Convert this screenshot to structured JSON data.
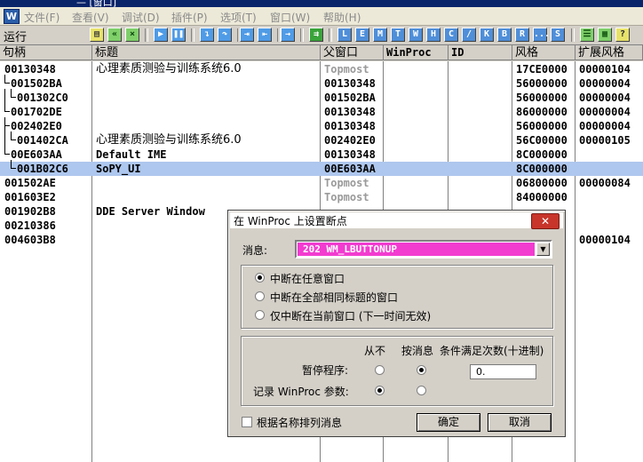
{
  "window": {
    "title_fragment": "— [窗口]"
  },
  "menu": [
    "文件(F)",
    "查看(V)",
    "调试(D)",
    "插件(P)",
    "选项(T)",
    "窗口(W)",
    "帮助(H)"
  ],
  "app_icon_letter": "W",
  "toolbar": {
    "run_label": "运行",
    "letter_buttons": [
      "L",
      "E",
      "M",
      "T",
      "W",
      "H",
      "C",
      "/",
      "K",
      "B",
      "R",
      "...",
      "S"
    ]
  },
  "columns": [
    "句柄",
    "标题",
    "父窗口",
    "WinProc",
    "ID",
    "风格",
    "扩展风格"
  ],
  "rows": [
    {
      "handle": "00130348",
      "title": "心理素质测验与训练系统6.0",
      "parent": "Topmost",
      "parent_grey": true,
      "style": "17CE0000",
      "exstyle": "00000104"
    },
    {
      "handle": "001502BA",
      "title": "",
      "parent": "00130348",
      "style": "56000000",
      "exstyle": "00000004"
    },
    {
      "handle": "001302C0",
      "title": "",
      "parent": "001502BA",
      "style": "56000000",
      "exstyle": "00000004"
    },
    {
      "handle": "001702DE",
      "title": "",
      "parent": "00130348",
      "style": "86000000",
      "exstyle": "00000004"
    },
    {
      "handle": "002402E0",
      "title": "",
      "parent": "00130348",
      "style": "56000000",
      "exstyle": "00000004"
    },
    {
      "handle": "001402CA",
      "title": "心理素质测验与训练系统6.0",
      "parent": "002402E0",
      "style": "56C00000",
      "exstyle": "00000105"
    },
    {
      "handle": "00E603AA",
      "title": "Default IME",
      "parent": "00130348",
      "style": "8C000000",
      "exstyle": ""
    },
    {
      "handle": "001B02C6",
      "title": "SoPY_UI",
      "parent": "00E603AA",
      "style": "8C000000",
      "exstyle": "",
      "selected": true
    },
    {
      "handle": "001502AE",
      "title": "",
      "parent": "Topmost",
      "parent_grey": true,
      "style": "06800000",
      "exstyle": "00000084"
    },
    {
      "handle": "001603E2",
      "title": "",
      "parent": "Topmost",
      "parent_grey": true,
      "style": "84000000",
      "exstyle": ""
    },
    {
      "handle": "001902B8",
      "title": "DDE Server Window",
      "parent": "",
      "style": "",
      "exstyle": ""
    },
    {
      "handle": "00210386",
      "title": "",
      "parent": "",
      "style": "",
      "exstyle": ""
    },
    {
      "handle": "004603B8",
      "title": "",
      "parent": "",
      "style": "",
      "exstyle": "00000104"
    }
  ],
  "dialog": {
    "title": "在 WinProc 上设置断点",
    "close_label": "✕",
    "message_label": "消息:",
    "message_value": "202  WM_LBUTTONUP",
    "options": [
      {
        "label": "中断在任意窗口",
        "checked": true
      },
      {
        "label": "中断在全部相同标题的窗口",
        "checked": false
      },
      {
        "label": "仅中断在当前窗口 (下一时间无效)",
        "checked": false
      }
    ],
    "col_never": "从不",
    "col_by_msg": "按消息",
    "col_condition": "条件满足次数(十进制)",
    "pause_label": "暂停程序:",
    "log_label": "记录 WinProc 参数:",
    "count_value": "0.",
    "sort_label": "根据名称排列消息",
    "ok_label": "确定",
    "cancel_label": "取消"
  }
}
